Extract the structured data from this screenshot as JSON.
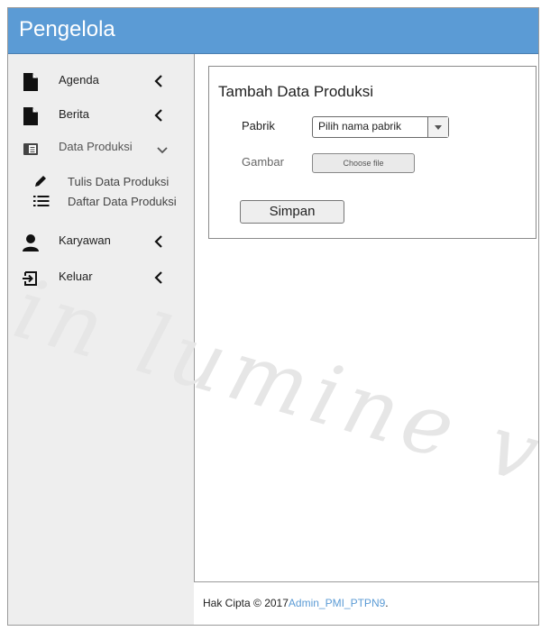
{
  "header": {
    "title": "Pengelola",
    "accent": "#5b9bd5"
  },
  "sidebar": {
    "items": [
      {
        "label": "Agenda",
        "icon": "document-icon",
        "chevron": "left"
      },
      {
        "label": "Berita",
        "icon": "document-icon",
        "chevron": "left"
      },
      {
        "label": "Data Produksi",
        "icon": "book-icon",
        "chevron": "down",
        "subitems": [
          {
            "label": "Tulis Data Produksi",
            "icon": "pencil-icon"
          },
          {
            "label": "Daftar Data Produksi",
            "icon": "list-icon"
          }
        ]
      },
      {
        "label": "Karyawan",
        "icon": "user-icon",
        "chevron": "left"
      },
      {
        "label": "Keluar",
        "icon": "logout-icon",
        "chevron": "left"
      }
    ]
  },
  "form": {
    "title": "Tambah Data Produksi",
    "pabrik_label": "Pabrik",
    "pabrik_value": "Pilih nama pabrik",
    "gambar_label": "Gambar",
    "file_button": "Choose file",
    "submit": "Simpan"
  },
  "watermark": "in lumine ve",
  "footer": {
    "copyright": "Hak Cipta © 2017",
    "brand": "Admin_PMI_PTPN9",
    "suffix": "."
  }
}
